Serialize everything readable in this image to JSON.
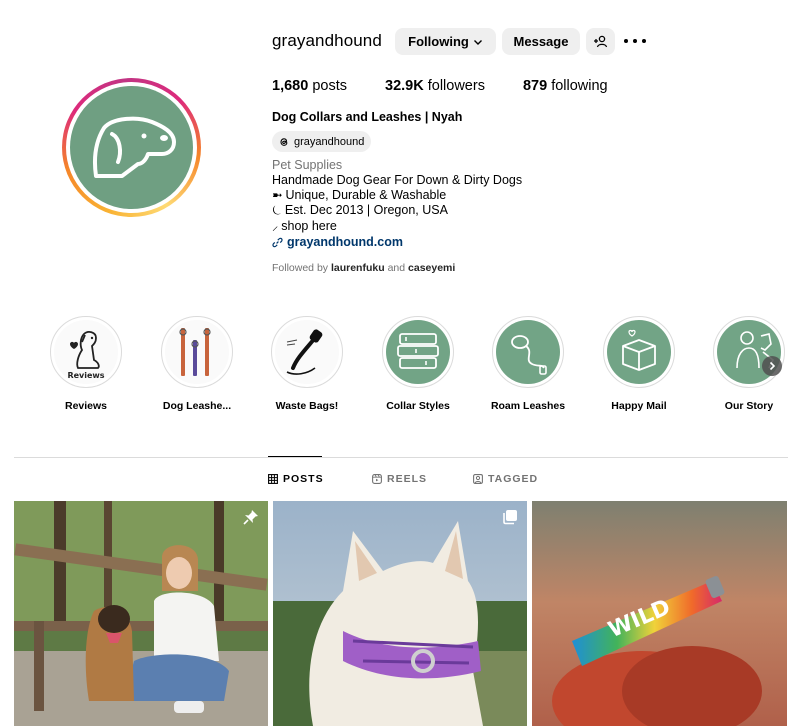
{
  "profile": {
    "username": "grayandhound",
    "buttons": {
      "following": "Following",
      "message": "Message"
    },
    "stats": {
      "posts_count": "1,680",
      "posts_label": "posts",
      "followers_count": "32.9K",
      "followers_label": "followers",
      "following_count": "879",
      "following_label": "following"
    },
    "full_name": "Dog Collars and Leashes | Nyah",
    "threads_handle": "grayandhound",
    "category": "Pet Supplies",
    "bio": [
      {
        "icon": "",
        "text": "Handmade Dog Gear For Down & Dirty Dogs"
      },
      {
        "icon": "➼",
        "text": "Unique, Durable & Washable"
      },
      {
        "icon": "⏾",
        "text": "Est. Dec 2013 | Oregon, USA"
      },
      {
        "icon": "⸝",
        "text": "shop here"
      }
    ],
    "link": "grayandhound.com",
    "followed_by": {
      "prefix": "Followed by",
      "user1": "laurenfuku",
      "conjunction": "and",
      "user2": "caseyemi"
    }
  },
  "highlights": [
    {
      "label": "Reviews"
    },
    {
      "label": "Dog Leashe..."
    },
    {
      "label": "Waste Bags!"
    },
    {
      "label": "Collar Styles"
    },
    {
      "label": "Roam Leashes"
    },
    {
      "label": "Happy Mail"
    },
    {
      "label": "Our Story"
    }
  ],
  "highlight_text": {
    "reviews_badge": "Reviews"
  },
  "tabs": {
    "posts": "POSTS",
    "reels": "REELS",
    "tagged": "TAGGED"
  },
  "posts": [
    {
      "badge": "pin-icon"
    },
    {
      "badge": "carousel-icon"
    },
    {
      "badge": "",
      "collar_text": "WILD"
    }
  ],
  "colors": {
    "brand_green": "#72a486",
    "link_blue": "#00376b",
    "button_gray": "#efefef"
  }
}
